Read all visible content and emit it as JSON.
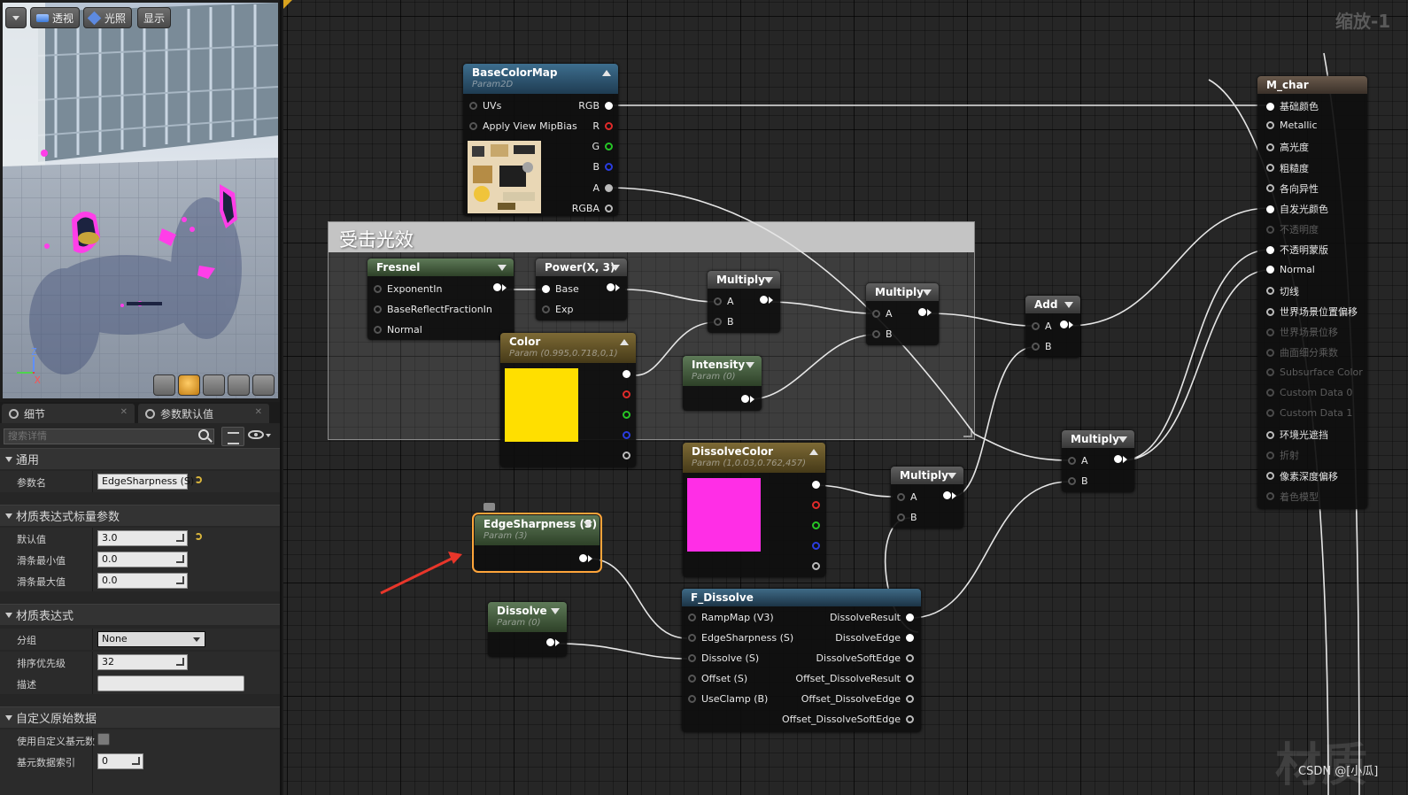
{
  "viewport": {
    "dropdown_icon": "chevron-down-icon",
    "perspective_label": "透视",
    "lit_label": "光照",
    "show_label": "显示",
    "axis_z": "Z",
    "axis_x": "X",
    "toolbar_icons": [
      "cylinder-icon",
      "sphere-icon",
      "plane-icon",
      "cube-icon",
      "teapot-icon"
    ]
  },
  "details": {
    "tab_details": "细节",
    "tab_param_defaults": "参数默认值",
    "search_placeholder": "搜索详情",
    "sections": {
      "general": "通用",
      "scalar_param": "材质表达式标量参数",
      "expression": "材质表达式",
      "custom_primitive": "自定义原始数据"
    },
    "general": {
      "param_name_label": "参数名",
      "param_name_value": "EdgeSharpness (S)"
    },
    "scalar": {
      "default_label": "默认值",
      "default_value": "3.0",
      "slider_min_label": "滑条最小值",
      "slider_min_value": "0.0",
      "slider_max_label": "滑条最大值",
      "slider_max_value": "0.0"
    },
    "expression": {
      "group_label": "分组",
      "group_value": "None",
      "priority_label": "排序优先级",
      "priority_value": "32",
      "desc_label": "描述",
      "desc_value": ""
    },
    "custom": {
      "use_custom_label": "使用自定义基元数",
      "index_label": "基元数据索引",
      "index_value": "0"
    }
  },
  "graph": {
    "zoom_label": "缩放-1",
    "comment_title": "受击光效",
    "nodes": {
      "basecolormap": {
        "title": "BaseColorMap",
        "subtitle": "Param2D",
        "in": [
          "UVs",
          "Apply View MipBias"
        ],
        "out": [
          "RGB",
          "R",
          "G",
          "B",
          "A",
          "RGBA"
        ]
      },
      "fresnel": {
        "title": "Fresnel",
        "in": [
          "ExponentIn",
          "BaseReflectFractionIn",
          "Normal"
        ]
      },
      "power": {
        "title": "Power(X, 3)",
        "in": [
          "Base",
          "Exp"
        ]
      },
      "color": {
        "title": "Color",
        "subtitle": "Param (0.995,0.718,0,1)",
        "swatch": "#ffdf00"
      },
      "multiply1": {
        "title": "Multiply",
        "in": [
          "A",
          "B"
        ]
      },
      "intensity": {
        "title": "Intensity",
        "subtitle": "Param (0)"
      },
      "multiply2": {
        "title": "Multiply",
        "in": [
          "A",
          "B"
        ]
      },
      "add": {
        "title": "Add",
        "in": [
          "A",
          "B"
        ]
      },
      "multiply3": {
        "title": "Multiply",
        "in": [
          "A",
          "B"
        ]
      },
      "dissolvecolor": {
        "title": "DissolveColor",
        "subtitle": "Param (1,0.03,0.762,457)",
        "swatch": "#ff2ee6"
      },
      "multiply4": {
        "title": "Multiply",
        "in": [
          "A",
          "B"
        ]
      },
      "edgesharp": {
        "title": "EdgeSharpness (S)",
        "subtitle": "Param (3)"
      },
      "dissolve": {
        "title": "Dissolve",
        "subtitle": "Param (0)"
      },
      "fdissolve": {
        "title": "F_Dissolve",
        "in": [
          "RampMap (V3)",
          "EdgeSharpness (S)",
          "Dissolve (S)",
          "Offset (S)",
          "UseClamp (B)"
        ],
        "out": [
          "DissolveResult",
          "DissolveEdge",
          "DissolveSoftEdge",
          "Offset_DissolveResult",
          "Offset_DissolveEdge",
          "Offset_DissolveSoftEdge"
        ]
      },
      "mchar": {
        "title": "M_char",
        "pins": [
          "基础颜色",
          "Metallic",
          "高光度",
          "粗糙度",
          "各向异性",
          "自发光颜色",
          "不透明度",
          "不透明蒙版",
          "Normal",
          "切线",
          "世界场景位置偏移",
          "世界场景位移",
          "曲面细分乘数",
          "Subsurface Color",
          "Custom Data 0",
          "Custom Data 1",
          "环境光遮挡",
          "折射",
          "像素深度偏移",
          "着色模型"
        ]
      }
    }
  },
  "watermark": "材质",
  "credit": "CSDN @[小瓜]",
  "colors": {
    "selection": "#ffa53a",
    "arrow": "#e8362a"
  }
}
